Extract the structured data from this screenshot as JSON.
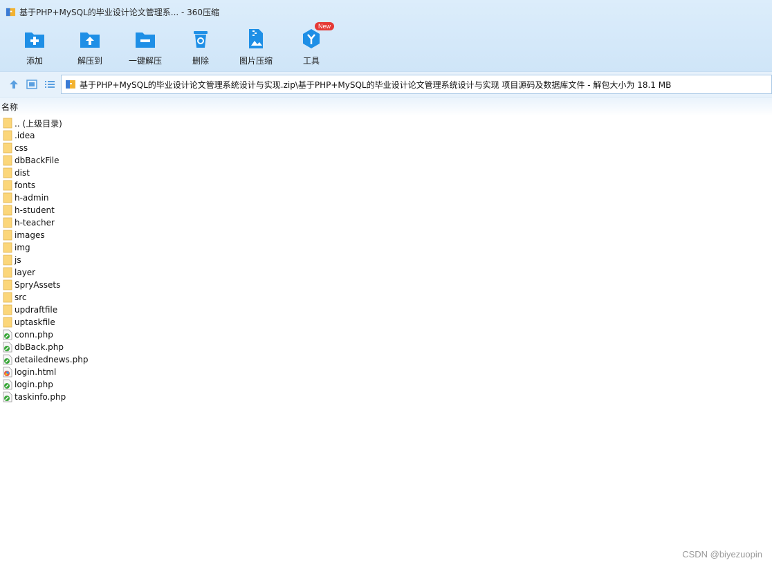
{
  "window": {
    "title": "基于PHP+MySQL的毕业设计论文管理系... - 360压缩"
  },
  "toolbar": {
    "buttons": [
      {
        "label": "添加",
        "icon": "add-folder-icon"
      },
      {
        "label": "解压到",
        "icon": "extract-to-icon"
      },
      {
        "label": "一键解压",
        "icon": "one-click-extract-icon"
      },
      {
        "label": "删除",
        "icon": "delete-icon"
      },
      {
        "label": "图片压缩",
        "icon": "image-compress-icon"
      },
      {
        "label": "工具",
        "icon": "tools-icon"
      }
    ],
    "tools_badge": "New"
  },
  "address": {
    "path": "基于PHP+MySQL的毕业设计论文管理系统设计与实现.zip\\基于PHP+MySQL的毕业设计论文管理系统设计与实现 项目源码及数据库文件 - 解包大小为 18.1 MB"
  },
  "list": {
    "column_name": "名称",
    "items": [
      {
        "name": ".. (上级目录)",
        "type": "folder"
      },
      {
        "name": ".idea",
        "type": "folder"
      },
      {
        "name": "css",
        "type": "folder"
      },
      {
        "name": "dbBackFile",
        "type": "folder"
      },
      {
        "name": "dist",
        "type": "folder"
      },
      {
        "name": "fonts",
        "type": "folder"
      },
      {
        "name": "h-admin",
        "type": "folder"
      },
      {
        "name": "h-student",
        "type": "folder"
      },
      {
        "name": "h-teacher",
        "type": "folder"
      },
      {
        "name": "images",
        "type": "folder"
      },
      {
        "name": "img",
        "type": "folder"
      },
      {
        "name": "js",
        "type": "folder"
      },
      {
        "name": "layer",
        "type": "folder"
      },
      {
        "name": "SpryAssets",
        "type": "folder"
      },
      {
        "name": "src",
        "type": "folder"
      },
      {
        "name": "updraftfile",
        "type": "folder"
      },
      {
        "name": "uptaskfile",
        "type": "folder"
      },
      {
        "name": "conn.php",
        "type": "php"
      },
      {
        "name": "dbBack.php",
        "type": "php"
      },
      {
        "name": "detailednews.php",
        "type": "php"
      },
      {
        "name": "login.html",
        "type": "html"
      },
      {
        "name": "login.php",
        "type": "php"
      },
      {
        "name": "taskinfo.php",
        "type": "php"
      }
    ]
  },
  "watermark": "CSDN @biyezuopin",
  "colors": {
    "accent": "#1e8fe6",
    "folder": "#fbd67a",
    "badge": "#e53935"
  }
}
